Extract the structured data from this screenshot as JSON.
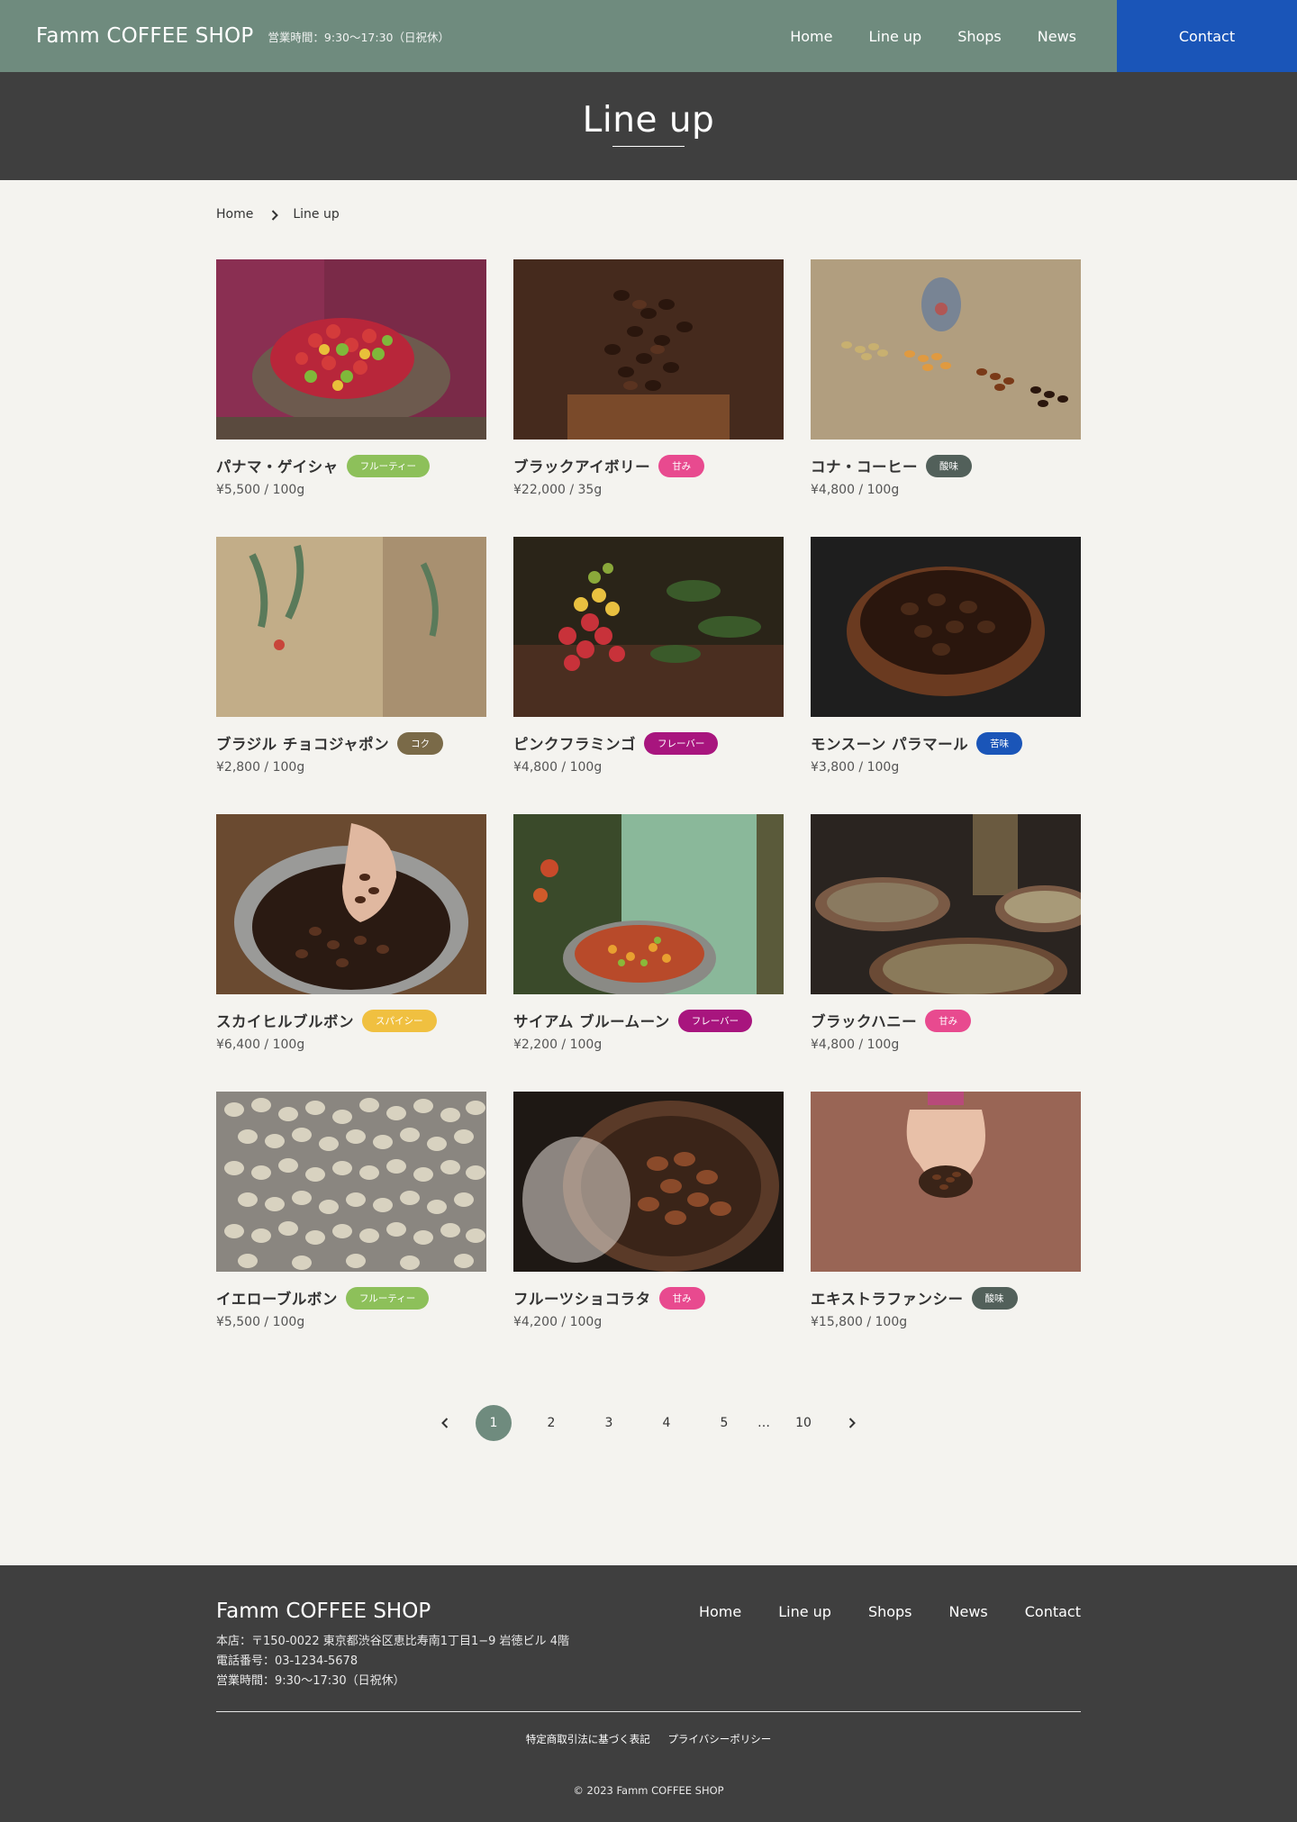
{
  "header": {
    "brand": "Famm COFFEE SHOP",
    "hours": "営業時間：9:30〜17:30（日祝休）",
    "nav": [
      "Home",
      "Line up",
      "Shops",
      "News"
    ],
    "contact": "Contact",
    "bg_color": "#6f8b7e",
    "contact_color": "#1a55b8"
  },
  "hero": {
    "title": "Line up"
  },
  "breadcrumb": {
    "home": "Home",
    "current": "Line up",
    "separator_icon": "chevron-right-icon"
  },
  "products": [
    {
      "name": "パナマ・ゲイシャ",
      "tag": "フルーティー",
      "tag_color": "#8dc05a",
      "price": "¥5,500 / 100g",
      "image": "coffee-cherries-in-hands"
    },
    {
      "name": "ブラックアイボリー",
      "tag": "甘み",
      "tag_color": "#e84a8f",
      "price": "¥22,000 / 35g",
      "image": "beans-pouring-from-grinder"
    },
    {
      "name": "コナ・コーヒー",
      "tag": "酸味",
      "tag_color": "#52605a",
      "price": "¥4,800 / 100g",
      "image": "beans-on-burlap-sack"
    },
    {
      "name": "ブラジル チョコジャポン",
      "tag": "コク",
      "tag_color": "#7a6a48",
      "price": "¥2,800 / 100g",
      "image": "burlap-sacks-cafes-do-brasil"
    },
    {
      "name": "ピンクフラミンゴ",
      "tag": "フレーバー",
      "tag_color": "#a8157e",
      "price": "¥4,800 / 100g",
      "image": "coffee-cherries-on-branch"
    },
    {
      "name": "モンスーン パラマール",
      "tag": "苦味",
      "tag_color": "#1a55b8",
      "price": "¥3,800 / 100g",
      "image": "beans-in-wooden-bowl"
    },
    {
      "name": "スカイヒルブルボン",
      "tag": "スパイシー",
      "tag_color": "#f0c040",
      "price": "¥6,400 / 100g",
      "image": "hand-holding-roasted-beans"
    },
    {
      "name": "サイアム ブルームーン",
      "tag": "フレーバー",
      "tag_color": "#a8157e",
      "price": "¥2,200 / 100g",
      "image": "harvesting-cherries-basket"
    },
    {
      "name": "ブラックハニー",
      "tag": "甘み",
      "tag_color": "#e84a8f",
      "price": "¥4,800 / 100g",
      "image": "beans-in-clay-bowls"
    },
    {
      "name": "イエローブルボン",
      "tag": "フルーティー",
      "tag_color": "#8dc05a",
      "price": "¥5,500 / 100g",
      "image": "green-beans-on-mesh"
    },
    {
      "name": "フルーツショコラタ",
      "tag": "甘み",
      "tag_color": "#e84a8f",
      "price": "¥4,200 / 100g",
      "image": "roasted-beans-in-bowl"
    },
    {
      "name": "エキストラファンシー",
      "tag": "酸味",
      "tag_color": "#52605a",
      "price": "¥15,800 / 100g",
      "image": "cupped-hands-with-beans"
    }
  ],
  "pagination": {
    "pages": [
      "1",
      "2",
      "3",
      "4",
      "5"
    ],
    "ellipsis": "…",
    "last": "10",
    "current": "1",
    "prev_icon": "chevron-left-icon",
    "next_icon": "chevron-right-icon"
  },
  "footer": {
    "brand": "Famm COFFEE SHOP",
    "nav": [
      "Home",
      "Line up",
      "Shops",
      "News",
      "Contact"
    ],
    "address": "本店：〒150-0022 東京都渋谷区恵比寿南1丁目1−9 岩徳ビル 4階",
    "phone": "電話番号：03-1234-5678",
    "hours": "営業時間：9:30〜17:30（日祝休）",
    "links": [
      "特定商取引法に基づく表記",
      "プライバシーポリシー"
    ],
    "copyright": "© 2023 Famm COFFEE SHOP"
  }
}
